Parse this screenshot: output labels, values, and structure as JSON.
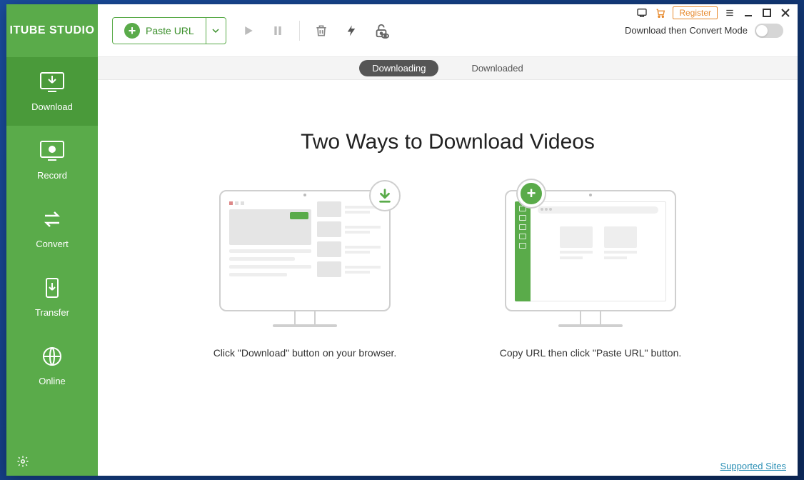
{
  "brand": "ITUBE STUDIO",
  "titlebar": {
    "register_label": "Register"
  },
  "sidebar": {
    "items": [
      {
        "label": "Download",
        "icon": "download-icon",
        "active": true
      },
      {
        "label": "Record",
        "icon": "record-icon",
        "active": false
      },
      {
        "label": "Convert",
        "icon": "convert-icon",
        "active": false
      },
      {
        "label": "Transfer",
        "icon": "transfer-icon",
        "active": false
      },
      {
        "label": "Online",
        "icon": "online-icon",
        "active": false
      }
    ]
  },
  "toolbar": {
    "paste_url_label": "Paste URL",
    "convert_mode_label": "Download then Convert Mode"
  },
  "tabs": {
    "downloading": "Downloading",
    "downloaded": "Downloaded"
  },
  "content": {
    "headline": "Two Ways to Download Videos",
    "method_a": "Click \"Download\" button on your browser.",
    "method_b": "Copy URL then click \"Paste URL\" button."
  },
  "footer": {
    "supported_sites": "Supported Sites"
  }
}
